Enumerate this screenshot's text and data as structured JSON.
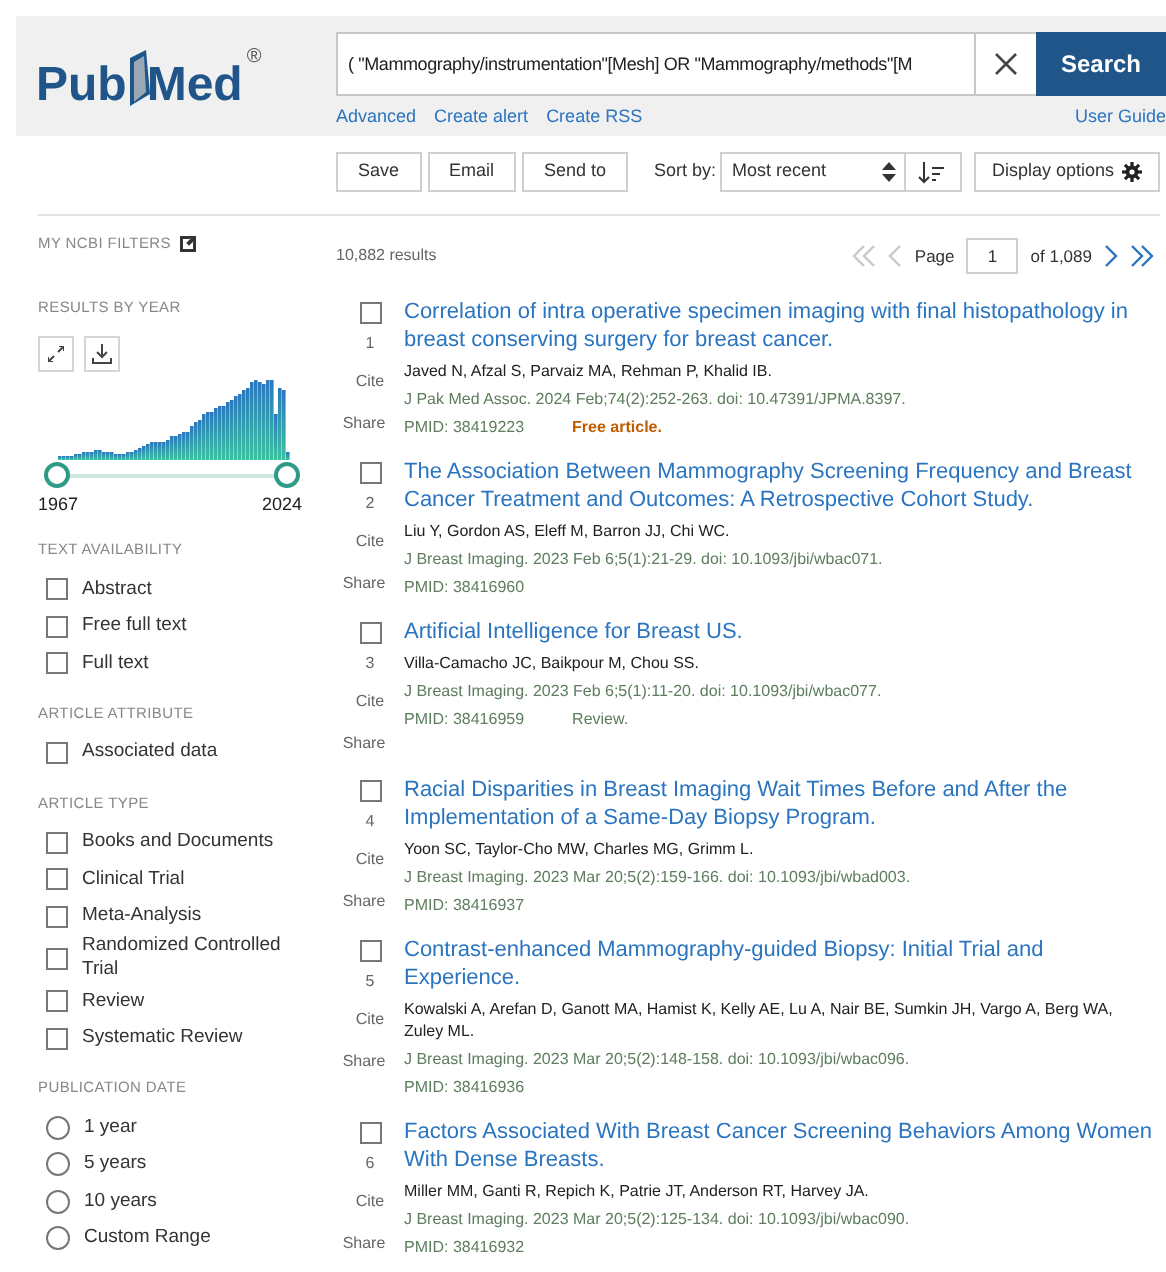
{
  "header": {
    "logo": {
      "left": "Pub",
      "right": "Med",
      "mark": "®"
    },
    "search": {
      "value": "( \"Mammography/instrumentation\"[Mesh] OR \"Mammography/methods\"[M"
    },
    "search_button": "Search",
    "links": [
      "Advanced",
      "Create alert",
      "Create RSS"
    ],
    "user_guide": "User Guide"
  },
  "toolbar": {
    "buttons": [
      "Save",
      "Email",
      "Send to"
    ],
    "sort_label": "Sort by:",
    "sort_value": "Most recent",
    "display_options": "Display options"
  },
  "sidebar": {
    "my_filters": "MY NCBI FILTERS",
    "results_by_year": {
      "title": "RESULTS BY YEAR",
      "handles": [
        {
          "level": 0
        },
        {
          "level": 1
        }
      ],
      "start_year": "1967",
      "end_year": "2024"
    },
    "sections": [
      {
        "title": "TEXT AVAILABILITY",
        "kind": "checkbox",
        "options": [
          {
            "label": "Abstract",
            "checked": false
          },
          {
            "label": "Free full text",
            "checked": false
          },
          {
            "label": "Full text",
            "checked": false
          }
        ]
      },
      {
        "title": "ARTICLE ATTRIBUTE",
        "kind": "checkbox",
        "options": [
          {
            "label": "Associated data",
            "checked": false
          }
        ]
      },
      {
        "title": "ARTICLE TYPE",
        "kind": "checkbox",
        "options": [
          {
            "label": "Books and Documents",
            "checked": false
          },
          {
            "label": "Clinical Trial",
            "checked": false
          },
          {
            "label": "Meta-Analysis",
            "checked": false
          },
          {
            "label": "Randomized Controlled Trial",
            "checked": false
          },
          {
            "label": "Review",
            "checked": false
          },
          {
            "label": "Systematic Review",
            "checked": false
          }
        ]
      },
      {
        "title": "PUBLICATION DATE",
        "kind": "radio",
        "options": [
          {
            "label": "1 year",
            "selected": false
          },
          {
            "label": "5 years",
            "selected": false
          },
          {
            "label": "10 years",
            "selected": false
          },
          {
            "label": "Custom Range",
            "selected": false
          }
        ]
      }
    ]
  },
  "results": {
    "count": "10,882 results",
    "pagination": {
      "previous_enabled": false,
      "next_enabled": true,
      "page_label": "Page",
      "page": "1",
      "of": "of 1,089"
    },
    "articles": [
      {
        "checked": false,
        "number": "1",
        "cite": "Cite",
        "share": "Share",
        "title": "Correlation of intra operative specimen imaging with final histopathology in breast conserving surgery for breast cancer.",
        "authors": "Javed N, Afzal S, Parvaiz MA, Rehman P, Khalid IB.",
        "citation": "J Pak Med Assoc. 2024 Feb;74(2):252-263. doi: 10.47391/JPMA.8397.",
        "pmid": "PMID: 38419223",
        "note": {
          "kind": "free",
          "text": "Free article."
        }
      },
      {
        "checked": false,
        "number": "2",
        "cite": "Cite",
        "share": "Share",
        "title": "The Association Between Mammography Screening Frequency and Breast Cancer Treatment and Outcomes: A Retrospective Cohort Study.",
        "authors": "Liu Y, Gordon AS, Eleff M, Barron JJ, Chi WC.",
        "citation": "J Breast Imaging. 2023 Feb 6;5(1):21-29. doi: 10.1093/jbi/wbac071.",
        "pmid": "PMID: 38416960"
      },
      {
        "checked": false,
        "number": "3",
        "cite": "Cite",
        "share": "Share",
        "title": "Artificial Intelligence for Breast US.",
        "authors": "Villa-Camacho JC, Baikpour M, Chou SS.",
        "citation": "J Breast Imaging. 2023 Feb 6;5(1):11-20. doi: 10.1093/jbi/wbac077.",
        "pmid": "PMID: 38416959",
        "note": {
          "kind": "type",
          "text": "Review."
        }
      },
      {
        "checked": false,
        "number": "4",
        "cite": "Cite",
        "share": "Share",
        "title": "Racial Disparities in Breast Imaging Wait Times Before and After the Implementation of a Same-Day Biopsy Program.",
        "authors": "Yoon SC, Taylor-Cho MW, Charles MG, Grimm L.",
        "citation": "J Breast Imaging. 2023 Mar 20;5(2):159-166. doi: 10.1093/jbi/wbad003.",
        "pmid": "PMID: 38416937"
      },
      {
        "checked": false,
        "number": "5",
        "cite": "Cite",
        "share": "Share",
        "title": "Contrast-enhanced Mammography-guided Biopsy: Initial Trial and Experience.",
        "authors": "Kowalski A, Arefan D, Ganott MA, Hamist K, Kelly AE, Lu A, Nair BE, Sumkin JH, Vargo A, Berg WA, Zuley ML.",
        "citation": "J Breast Imaging. 2023 Mar 20;5(2):148-158. doi: 10.1093/jbi/wbac096.",
        "pmid": "PMID: 38416936"
      },
      {
        "checked": false,
        "number": "6",
        "cite": "Cite",
        "share": "Share",
        "title": "Factors Associated With Breast Cancer Screening Behaviors Among Women With Dense Breasts.",
        "authors": "Miller MM, Ganti R, Repich K, Patrie JT, Anderson RT, Harvey JA.",
        "citation": "J Breast Imaging. 2023 Mar 20;5(2):125-134. doi: 10.1093/jbi/wbac090.",
        "pmid": "PMID: 38416932"
      }
    ]
  }
}
